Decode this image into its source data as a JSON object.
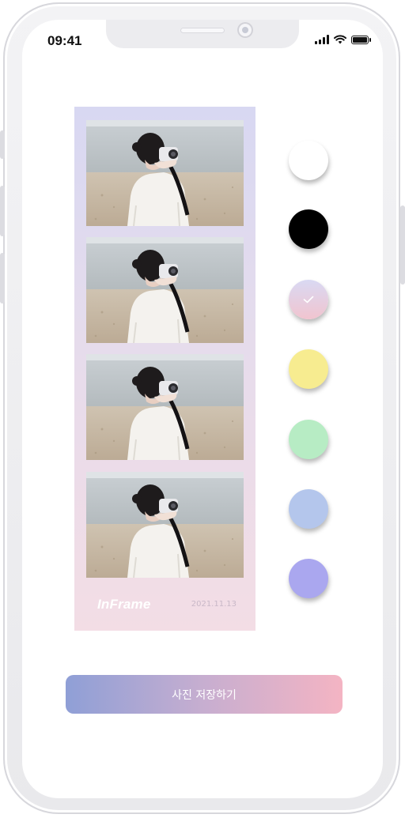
{
  "status_bar": {
    "time": "09:41",
    "icons": [
      "signal-icon",
      "wifi-icon",
      "battery-icon"
    ]
  },
  "photo_strip": {
    "photos": [
      {
        "icon": "photo-woman-with-camera-on-beach"
      },
      {
        "icon": "photo-woman-with-camera-on-beach"
      },
      {
        "icon": "photo-woman-with-camera-on-beach"
      },
      {
        "icon": "photo-woman-with-camera-on-beach"
      }
    ],
    "logo": "InFrame",
    "date": "2021.11.13"
  },
  "colors": {
    "swatches": [
      "#ffffff",
      "#000000",
      "gradient-lavender-pink",
      "#f7ec90",
      "#b7ecc4",
      "#b4c6ec",
      "#aaa7ef"
    ],
    "selected_index": 2,
    "button_gradient": [
      "#8f9fd6",
      "#f4b4c3"
    ]
  },
  "actions": {
    "save_label": "사진 저장하기"
  }
}
